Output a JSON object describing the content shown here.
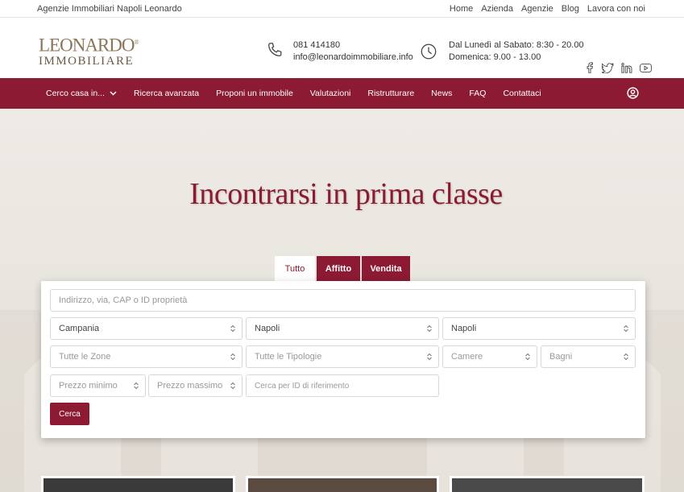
{
  "topbar": {
    "tagline": "Agenzie Immobiliari Napoli Leonardo",
    "links": [
      "Home",
      "Azienda",
      "Agenzie",
      "Blog",
      "Lavora con noi"
    ]
  },
  "logo": {
    "line1": "LEONARDO",
    "line2": "IMMOBILIARE",
    "mark": "®"
  },
  "contact": {
    "phone": "081 414180",
    "email": "info@leonardoimmobiliare.info"
  },
  "hours": {
    "weekdays": "Dal Lunedì al Sabato: 8:30 - 20.00",
    "sunday": "Domenica: 9.00 - 13.00"
  },
  "social_icons": [
    "facebook-icon",
    "twitter-icon",
    "linkedin-icon",
    "youtube-icon"
  ],
  "nav": {
    "items": [
      "Cerco casa in...",
      "Ricerca avanzata",
      "Proponi un immobile",
      "Valutazioni",
      "Ristrutturare",
      "News",
      "FAQ",
      "Contattaci"
    ]
  },
  "hero": {
    "headline": "Incontrarsi in prima classe"
  },
  "search": {
    "tabs": [
      "Tutto",
      "Affitto",
      "Vendita"
    ],
    "address_placeholder": "Indirizzo, via, CAP o ID proprietà",
    "region": "Campania",
    "province": "Napoli",
    "city": "Napoli",
    "zones": "Tutte le Zone",
    "types": "Tutte le Tipologie",
    "rooms": "Camere",
    "baths": "Bagni",
    "price_min": "Prezzo minimo",
    "price_max": "Prezzo massimo",
    "ref_id_placeholder": "Cerca per ID di riferimento",
    "submit": "Cerca"
  },
  "colors": {
    "brand": "#8c1a32",
    "logo": "#8a7558"
  }
}
